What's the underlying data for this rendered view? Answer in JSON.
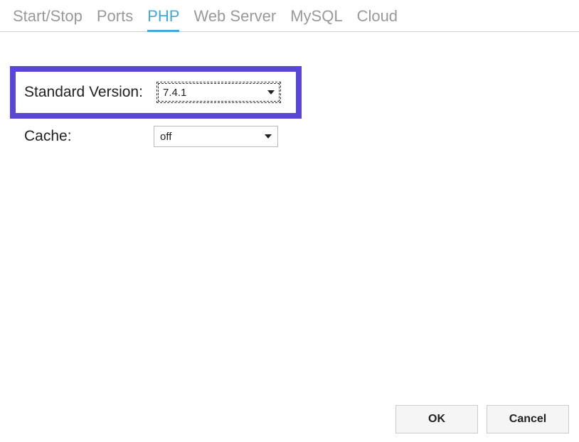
{
  "tabs": {
    "start_stop": "Start/Stop",
    "ports": "Ports",
    "php": "PHP",
    "web_server": "Web Server",
    "mysql": "MySQL",
    "cloud": "Cloud"
  },
  "form": {
    "standard_version_label": "Standard Version:",
    "standard_version_value": "7.4.1",
    "cache_label": "Cache:",
    "cache_value": "off"
  },
  "buttons": {
    "ok": "OK",
    "cancel": "Cancel"
  }
}
